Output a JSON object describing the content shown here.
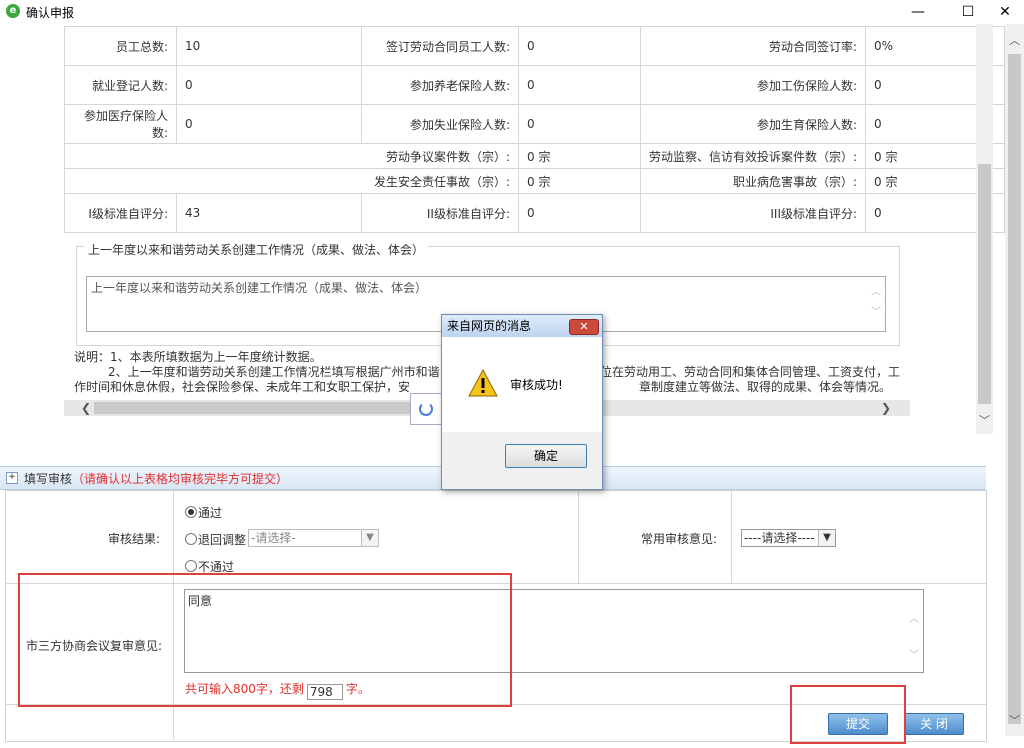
{
  "window": {
    "title": "确认申报",
    "minimize": "—",
    "maximize": "☐",
    "close": "✕"
  },
  "stats": [
    [
      {
        "label": "员工总数:",
        "value": "10"
      },
      {
        "label": "签订劳动合同员工人数:",
        "value": "0"
      },
      {
        "label": "劳动合同签订率:",
        "value": "0%"
      }
    ],
    [
      {
        "label": "就业登记人数:",
        "value": "0"
      },
      {
        "label": "参加养老保险人数:",
        "value": "0"
      },
      {
        "label": "参加工伤保险人数:",
        "value": "0"
      }
    ],
    [
      {
        "label": "参加医疗保险人数:",
        "value": "0"
      },
      {
        "label": "参加失业保险人数:",
        "value": "0"
      },
      {
        "label": "参加生育保险人数:",
        "value": "0"
      }
    ]
  ],
  "disputes": [
    [
      {
        "label": "劳动争议案件数（宗）:",
        "value": "0 宗"
      },
      {
        "label": "劳动监察、信访有效投诉案件数（宗）:",
        "value": "0 宗"
      }
    ],
    [
      {
        "label": "发生安全责任事故（宗）:",
        "value": "0 宗"
      },
      {
        "label": "职业病危害事故（宗）:",
        "value": "0 宗"
      }
    ]
  ],
  "scores": [
    {
      "label": "I级标准自评分:",
      "value": "43"
    },
    {
      "label": "II级标准自评分:",
      "value": "0"
    },
    {
      "label": "III级标准自评分:",
      "value": "0"
    }
  ],
  "work_section": {
    "legend": "上一年度以来和谐劳动关系创建工作情况（成果、做法、体会）",
    "placeholder": "上一年度以来和谐劳动关系创建工作情况（成果、做法、体会）"
  },
  "notes": {
    "line1": "说明：1、本表所填数据为上一年度统计数据。",
    "line2": "2、上一年度和谐劳动关系创建工作情况栏填写根据广州市和谐",
    "line2b": "位在劳动用工、劳动合同和集体合同管理、工资支付，工",
    "line3": "作时间和休息休假，社会保险参保、未成年工和女职工保护，安",
    "line3b": "章制度建立等做法、取得的成果、体会等情况。"
  },
  "dialog": {
    "title": "来自网页的消息",
    "close": "✕",
    "message": "审核成功!",
    "ok": "确定"
  },
  "review": {
    "toggle": "+",
    "title": "填写审核",
    "note": "（请确认以上表格均审核完毕方可提交）",
    "result_label": "审核结果:",
    "options": {
      "pass": "通过",
      "return": "退回调整",
      "reject": "不通过"
    },
    "return_select": "-请选择-",
    "common_label": "常用审核意见:",
    "common_select": "----请选择----",
    "opinion_label": "市三方协商会议复审意见:",
    "opinion_value": "同意",
    "count_prefix": "共可输入800字，还剩",
    "count_remaining": "798",
    "count_suffix": "字。"
  },
  "buttons": {
    "submit": "提交",
    "close": "关 闭"
  }
}
